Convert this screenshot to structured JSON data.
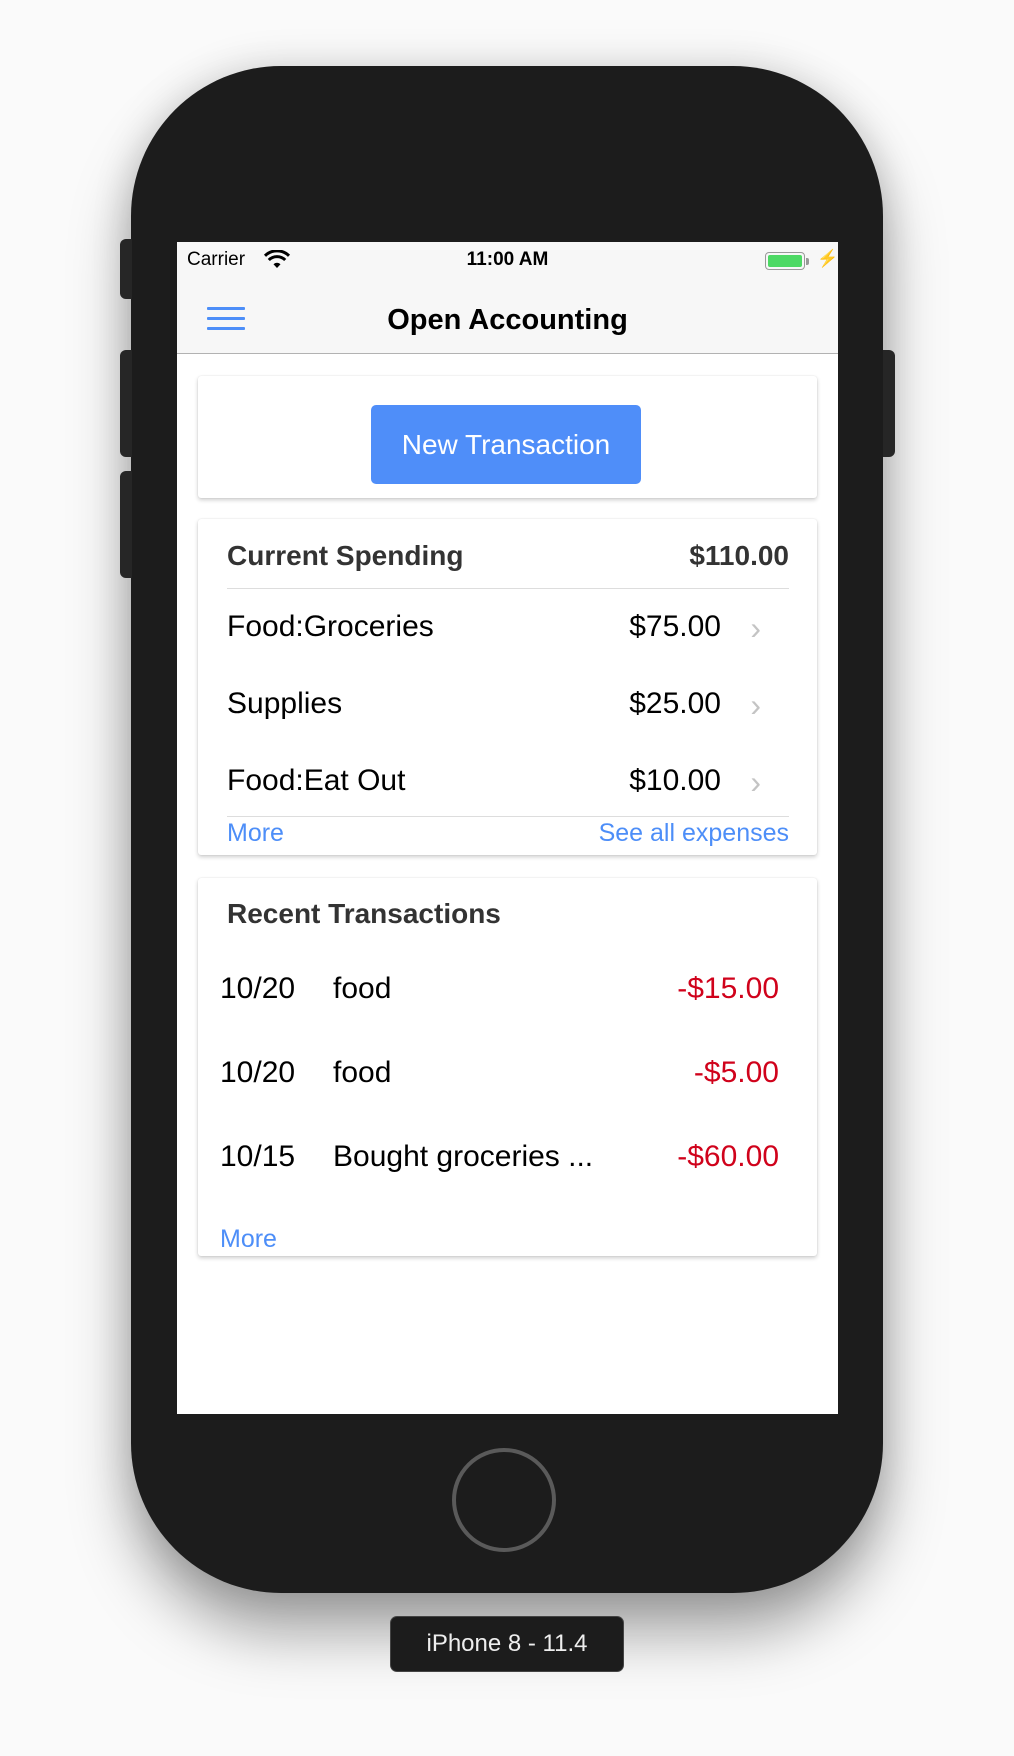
{
  "device": {
    "label": "iPhone 8 - 11.4"
  },
  "status_bar": {
    "carrier": "Carrier",
    "time": "11:00 AM",
    "wifi_icon": "wifi-icon",
    "battery_icon": "battery-charging-icon",
    "battery_level_percent": 100,
    "charging_glyph": "⚡"
  },
  "nav": {
    "title": "Open Accounting",
    "menu_icon": "hamburger-menu-icon"
  },
  "new_transaction": {
    "label": "New Transaction"
  },
  "current_spending": {
    "title": "Current Spending",
    "total": "$110.00",
    "items": [
      {
        "name": "Food:Groceries",
        "amount": "$75.00"
      },
      {
        "name": "Supplies",
        "amount": "$25.00"
      },
      {
        "name": "Food:Eat Out",
        "amount": "$10.00"
      }
    ],
    "chevron": "›",
    "more_label": "More",
    "see_all_label": "See all expenses"
  },
  "recent_transactions": {
    "title": "Recent Transactions",
    "items": [
      {
        "date": "10/20",
        "description": "food",
        "amount": "-$15.00"
      },
      {
        "date": "10/20",
        "description": "food",
        "amount": "-$5.00"
      },
      {
        "date": "10/15",
        "description": "Bought groceries ...",
        "amount": "-$60.00"
      }
    ],
    "more_label": "More"
  },
  "colors": {
    "accent": "#4f8ef9",
    "link": "#4d8ef8",
    "negative": "#d0021b",
    "battery": "#4cd964"
  }
}
